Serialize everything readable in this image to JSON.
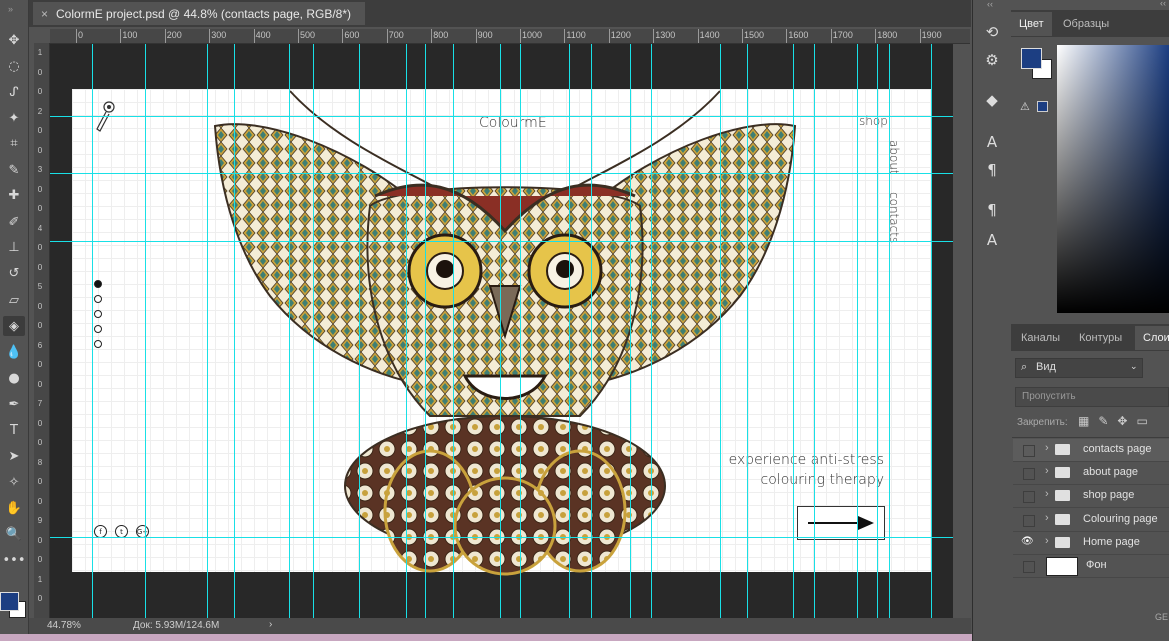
{
  "app": {
    "doc_tab_title": "ColormE project.psd @ 44.8% (contacts page, RGB/8*)",
    "close_glyph": "×",
    "zoom_level": "44.78%",
    "doc_info": "Док: 5.93M/124.6M",
    "status_arrow": "›",
    "panel_collapse": "‹‹"
  },
  "ruler": {
    "top_labels": [
      "0",
      "100",
      "200",
      "300",
      "400",
      "500",
      "600",
      "700",
      "800",
      "900",
      "1000",
      "1100",
      "1200",
      "1300",
      "1400",
      "1500",
      "1600",
      "1700",
      "1800",
      "1900"
    ],
    "left_labels": [
      "1",
      "0",
      "0",
      "2",
      "0",
      "0",
      "3",
      "0",
      "0",
      "4",
      "0",
      "0",
      "5",
      "0",
      "0",
      "6",
      "0",
      "0",
      "7",
      "0",
      "0",
      "8",
      "0",
      "0",
      "9",
      "0",
      "0",
      "1",
      "0"
    ]
  },
  "toolbar": {
    "tools": [
      {
        "name": "move-tool",
        "glyph": "✥"
      },
      {
        "name": "marquee-tool",
        "glyph": "◌"
      },
      {
        "name": "lasso-tool",
        "glyph": "ᔑ"
      },
      {
        "name": "magic-wand-tool",
        "glyph": "✦"
      },
      {
        "name": "crop-tool",
        "glyph": "⌗"
      },
      {
        "name": "eyedropper-tool",
        "glyph": "✎"
      },
      {
        "name": "healing-tool",
        "glyph": "✚"
      },
      {
        "name": "brush-tool",
        "glyph": "✐"
      },
      {
        "name": "stamp-tool",
        "glyph": "⊥"
      },
      {
        "name": "history-brush-tool",
        "glyph": "↺"
      },
      {
        "name": "eraser-tool",
        "glyph": "▱"
      },
      {
        "name": "paint-bucket-tool",
        "glyph": "◈"
      },
      {
        "name": "blur-tool",
        "glyph": "💧"
      },
      {
        "name": "dodge-tool",
        "glyph": "●"
      },
      {
        "name": "pen-tool",
        "glyph": "✒"
      },
      {
        "name": "type-tool",
        "glyph": "T"
      },
      {
        "name": "path-select-tool",
        "glyph": "➤"
      },
      {
        "name": "shape-tool",
        "glyph": "✧"
      },
      {
        "name": "hand-tool",
        "glyph": "✋"
      },
      {
        "name": "zoom-tool",
        "glyph": "🔍"
      },
      {
        "name": "more-tools",
        "glyph": "•••"
      }
    ]
  },
  "site": {
    "brand": "ColourmE",
    "nav_shop": "shop",
    "nav_about": "about",
    "nav_contacts": "contacts",
    "tagline_line1": "experience anti-stress",
    "tagline_line2": "colouring therapy",
    "social": [
      "f",
      "t",
      "G+"
    ]
  },
  "color_panel": {
    "tabs": [
      "Цвет",
      "Образцы"
    ],
    "fg_color": "#1c3e82",
    "bg_color": "#ffffff"
  },
  "layers_panel": {
    "tabs": [
      "Каналы",
      "Контуры",
      "Слои"
    ],
    "filter_label": "Вид",
    "opacity_label": "Пропустить",
    "lock_label": "Закрепить:",
    "layers": [
      {
        "name": "contacts page",
        "visible": false,
        "selected": true,
        "type": "folder"
      },
      {
        "name": "about page",
        "visible": false,
        "selected": false,
        "type": "folder"
      },
      {
        "name": "shop page",
        "visible": false,
        "selected": false,
        "type": "folder"
      },
      {
        "name": "Colouring page",
        "visible": false,
        "selected": false,
        "type": "folder"
      },
      {
        "name": "Home page",
        "visible": true,
        "selected": false,
        "type": "folder"
      },
      {
        "name": "Фон",
        "visible": false,
        "selected": false,
        "type": "fill"
      }
    ],
    "footer": "GE"
  },
  "right_icons": [
    "history-icon",
    "properties-icon",
    "3d-icon",
    "character-icon",
    "paragraph-icon",
    "paragraph-styles-icon",
    "character-styles-icon"
  ]
}
